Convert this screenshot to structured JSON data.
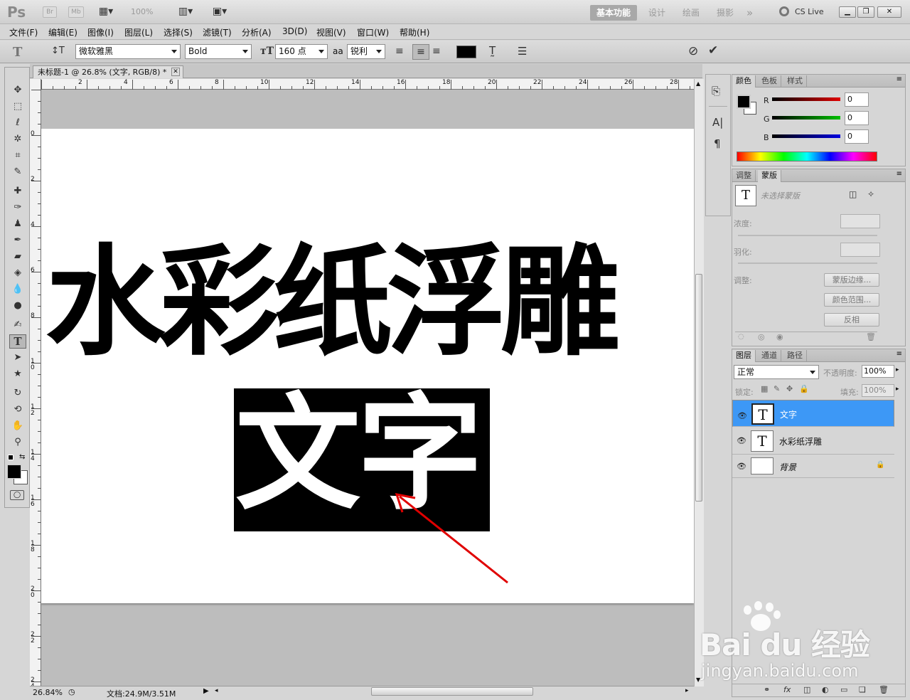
{
  "titlebar": {
    "logo": "Ps",
    "bridge": "Br",
    "minibridge": "Mb",
    "zoom": "100%",
    "workspaces": [
      "基本功能",
      "设计",
      "绘画",
      "摄影"
    ],
    "more": "»",
    "cslive": "CS Live"
  },
  "menu": [
    "文件(F)",
    "编辑(E)",
    "图像(I)",
    "图层(L)",
    "选择(S)",
    "滤镜(T)",
    "分析(A)",
    "3D(D)",
    "视图(V)",
    "窗口(W)",
    "帮助(H)"
  ],
  "options": {
    "font_family": "微软雅黑",
    "font_style": "Bold",
    "font_size": "160 点",
    "aa_label": "aa",
    "antialias": "锐利",
    "color": "#000000"
  },
  "document": {
    "tab_title": "未标题-1 @ 26.8% (文字, RGB/8) *",
    "close": "✕",
    "main_text": "水彩纸浮雕",
    "selected_text": "文字",
    "ruler_top": [
      "2",
      "4",
      "6",
      "8",
      "10",
      "12",
      "14",
      "16",
      "18",
      "20",
      "22",
      "24",
      "26",
      "28"
    ],
    "ruler_left": [
      "0",
      "2",
      "4",
      "6",
      "8",
      "10",
      "12",
      "14",
      "16",
      "18",
      "20",
      "22",
      "24"
    ]
  },
  "status": {
    "zoom": "26.84%",
    "doc": "文档:24.9M/3.51M"
  },
  "color_panel": {
    "tabs": [
      "颜色",
      "色板",
      "样式"
    ],
    "channels": [
      {
        "label": "R",
        "value": "0",
        "color": "#e00000"
      },
      {
        "label": "G",
        "value": "0",
        "color": "#00c000"
      },
      {
        "label": "B",
        "value": "0",
        "color": "#0000e0"
      }
    ]
  },
  "masks_panel": {
    "tabs": [
      "调整",
      "蒙版"
    ],
    "no_mask": "未选择蒙版",
    "density": "浓度:",
    "feather": "羽化:",
    "refine": "调整:",
    "buttons": [
      "蒙版边缘...",
      "颜色范围...",
      "反相"
    ]
  },
  "layers_panel": {
    "tabs": [
      "图层",
      "通道",
      "路径"
    ],
    "blend_mode": "正常",
    "opacity_label": "不透明度:",
    "opacity": "100%",
    "lock_label": "锁定:",
    "fill_label": "填充:",
    "fill": "100%",
    "layers": [
      {
        "name": "文字",
        "thumb": "T",
        "selected": true
      },
      {
        "name": "水彩纸浮雕",
        "thumb": "T",
        "selected": false
      },
      {
        "name": "背景",
        "thumb": "",
        "selected": false
      }
    ]
  },
  "watermark": {
    "brand": "Bai du 经验",
    "url": "jingyan.baidu.com"
  }
}
